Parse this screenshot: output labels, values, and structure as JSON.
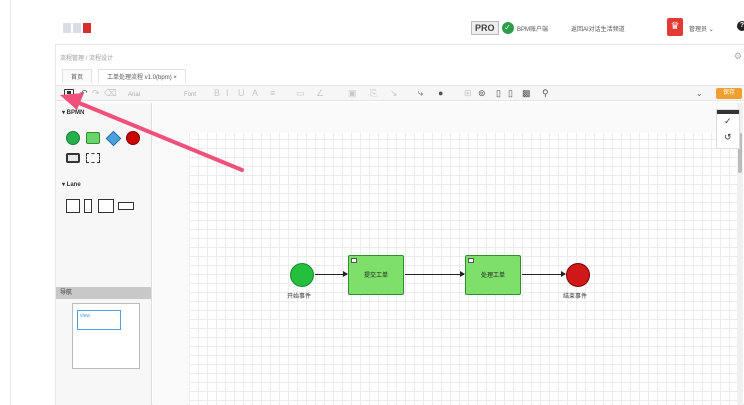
{
  "app": {
    "pro_label": "PRO",
    "pro_check": "✓",
    "links": [
      "BPM账户端",
      "返回AI对话生活频道"
    ],
    "user_name": "管理员",
    "user_caret": "⌄",
    "help": "?"
  },
  "panel": {
    "breadcrumb": "流程管理 / 流程设计",
    "gear": "⚙",
    "tabs": [
      "首页",
      "工单处理流程 v1.0(bpm) ×"
    ]
  },
  "toolbar": {
    "icons": [
      "save-icon",
      "undo-icon",
      "redo-icon",
      "delete-icon",
      "zoom-icon",
      "align-icon",
      "layout-icon",
      "settings-icon",
      "grid-icon",
      "export-icon"
    ],
    "text_items": [
      "Arial",
      "Font",
      "B",
      "I",
      "U"
    ],
    "orange_button": "保存",
    "caret": "⌄"
  },
  "sidebar": {
    "section_general": "▾ BPMN",
    "section_lane": "▾ Lane",
    "minimap_title": "导航",
    "minimap_label": "view"
  },
  "diagram": {
    "start_label": "开始事件",
    "task1_label": "提交工单",
    "task2_label": "处理工单",
    "end_label": "结束事件"
  },
  "right_panel": {
    "check": "✓",
    "history": "↺"
  },
  "colors": {
    "start": "#22c03c",
    "task": "#7ee06a",
    "end": "#d01818",
    "orange": "#f0a030",
    "arrow": "#f0507a"
  }
}
